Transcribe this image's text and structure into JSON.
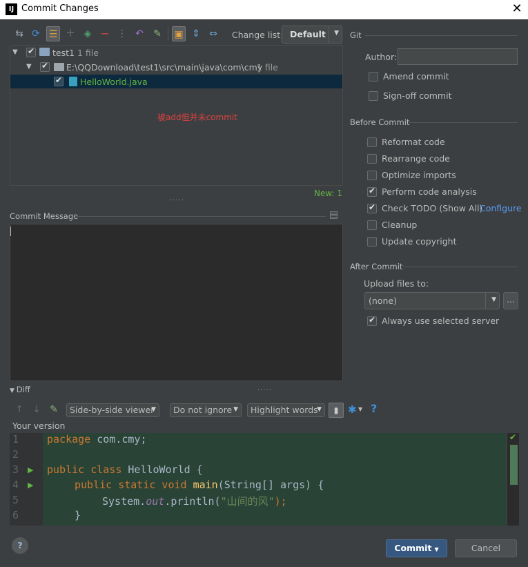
{
  "window": {
    "title": "Commit Changes",
    "logo": "IJ"
  },
  "toolbar": {
    "changelist_label": "Change list:",
    "changelist_value": "Default"
  },
  "tree": {
    "root_name": "test1",
    "root_count": "1 file",
    "path": "E:\\QQDownload\\test1\\src\\main\\java\\com\\cmy",
    "path_count": "1 file",
    "file": "HelloWorld.java",
    "annotation": "被add但并未commit",
    "new_count": "New: 1"
  },
  "commit_message": {
    "label": "Commit Message",
    "value": ""
  },
  "git": {
    "header": "Git",
    "author_label": "Author:",
    "author_value": "",
    "amend": "Amend commit",
    "signoff": "Sign-off commit"
  },
  "before_commit": {
    "header": "Before Commit",
    "items": [
      {
        "label": "Reformat code",
        "checked": false
      },
      {
        "label": "Rearrange code",
        "checked": false
      },
      {
        "label": "Optimize imports",
        "checked": false
      },
      {
        "label": "Perform code analysis",
        "checked": true
      },
      {
        "label": "Check TODO (Show All)",
        "checked": true
      },
      {
        "label": "Cleanup",
        "checked": false
      },
      {
        "label": "Update copyright",
        "checked": false
      }
    ],
    "configure_link": "Configure"
  },
  "after_commit": {
    "header": "After Commit",
    "upload_label": "Upload files to:",
    "upload_value": "(none)",
    "more_button": "...",
    "always_use": "Always use selected server"
  },
  "diff": {
    "header": "Diff",
    "viewer": "Side-by-side viewer",
    "ignore": "Do not ignore",
    "highlight": "Highlight words",
    "help": "?",
    "version_label": "Your version",
    "line_numbers": [
      "1",
      "2",
      "3",
      "4",
      "5",
      "6"
    ],
    "code": {
      "l1_kw": "package",
      "l1_rest": " com.cmy;",
      "l3_kw": "public class",
      "l3_rest": " HelloWorld {",
      "l4_kw": "public static void",
      "l4_fn": "main",
      "l4_rest": "(String[] args) {",
      "l5_a": "System.",
      "l5_it": "out",
      "l5_b": ".println(",
      "l5_str": "\"山间的风\"",
      "l5_c": ");",
      "l6": "}"
    }
  },
  "footer": {
    "help": "?",
    "commit": "Commit",
    "cancel": "Cancel"
  },
  "colors": {
    "background": "#3c3f41",
    "selection": "#0d293e",
    "code_bg": "#294436",
    "link": "#589df6"
  }
}
